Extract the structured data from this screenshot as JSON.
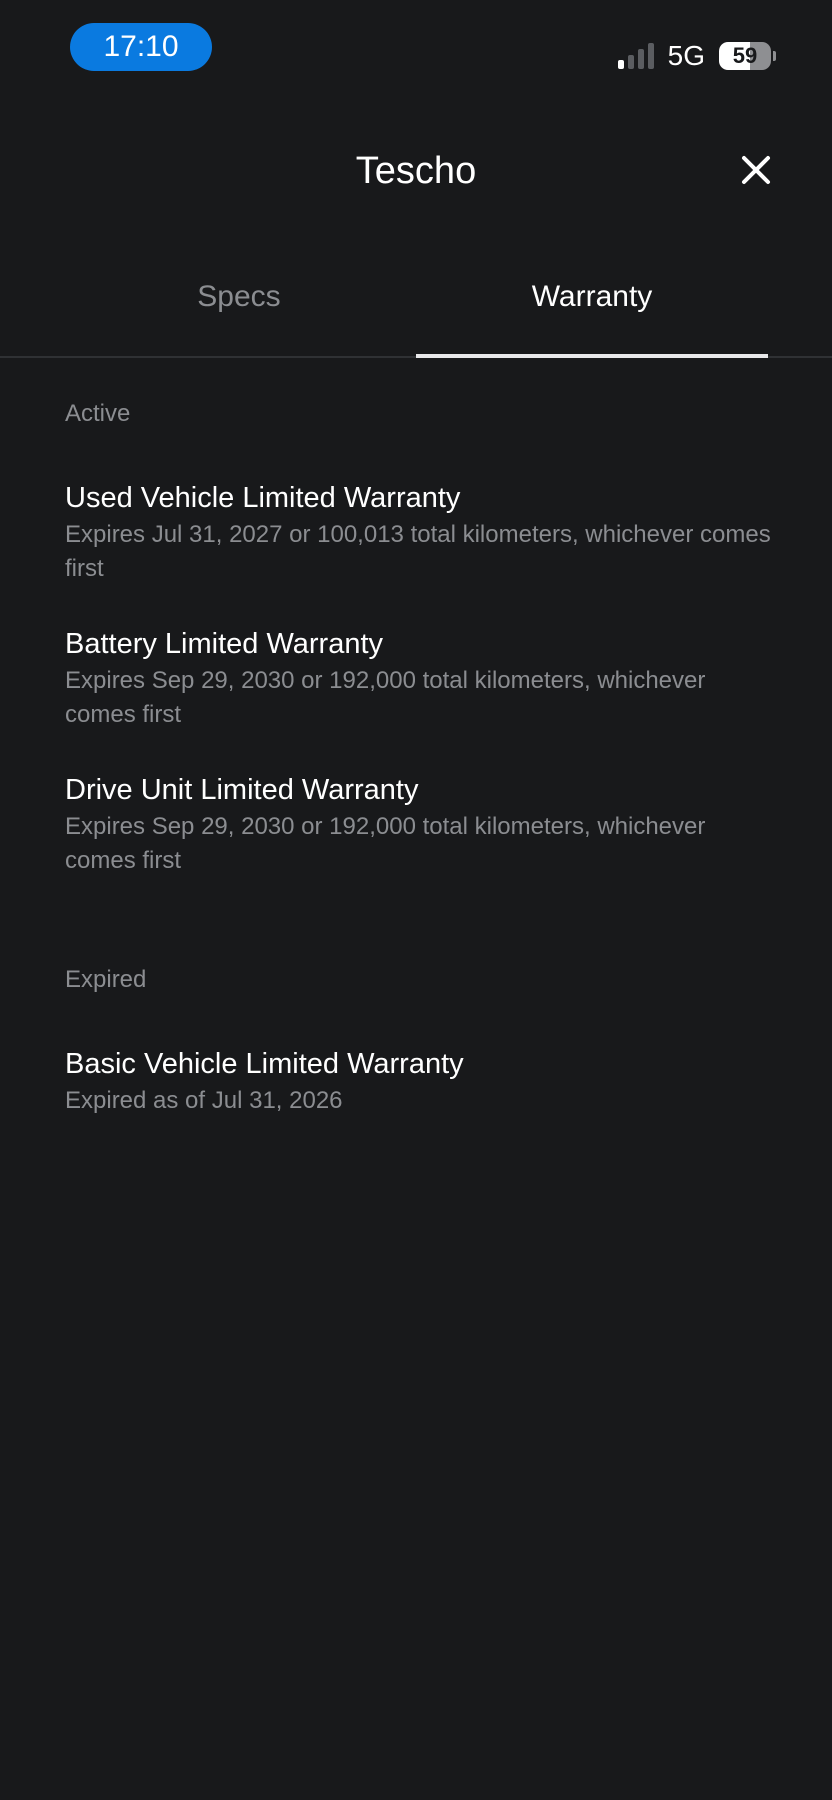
{
  "status_bar": {
    "time": "17:10",
    "network": "5G",
    "battery_level": "59",
    "battery_fraction": 0.59,
    "signal_bars_on": 1,
    "signal_bars_total": 4
  },
  "header": {
    "title": "Tescho",
    "close_icon": "close-icon"
  },
  "tabs": [
    {
      "label": "Specs",
      "selected": false
    },
    {
      "label": "Warranty",
      "selected": true
    }
  ],
  "sections": {
    "active": {
      "label": "Active",
      "items": [
        {
          "title": "Used Vehicle Limited Warranty",
          "detail": "Expires Jul 31, 2027 or 100,013 total kilometers, whichever comes first"
        },
        {
          "title": "Battery Limited Warranty",
          "detail": "Expires Sep 29, 2030 or 192,000 total kilometers, whichever comes first"
        },
        {
          "title": "Drive Unit Limited Warranty",
          "detail": "Expires Sep 29, 2030 or 192,000 total kilometers, whichever comes first"
        }
      ]
    },
    "expired": {
      "label": "Expired",
      "items": [
        {
          "title": "Basic Vehicle Limited Warranty",
          "detail": "Expired as of Jul 31, 2026"
        }
      ]
    }
  },
  "colors": {
    "background": "#18191b",
    "time_pill": "#0a7ae0",
    "muted_text": "#8b8d91",
    "primary_text": "#ffffff"
  }
}
